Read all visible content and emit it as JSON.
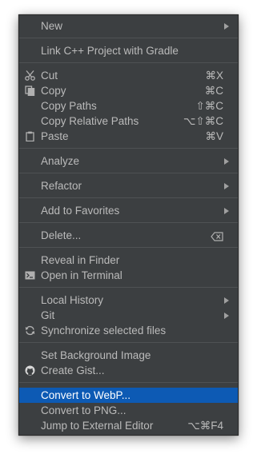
{
  "menu": {
    "new": {
      "label": "New"
    },
    "link_cpp": {
      "label": "Link C++ Project with Gradle"
    },
    "cut": {
      "label": "Cut",
      "shortcut": "⌘X",
      "icon": "scissors-icon"
    },
    "copy": {
      "label": "Copy",
      "shortcut": "⌘C",
      "icon": "copy-icon"
    },
    "copy_paths": {
      "label": "Copy Paths",
      "shortcut": "⇧⌘C"
    },
    "copy_relative_paths": {
      "label": "Copy Relative Paths",
      "shortcut": "⌥⇧⌘C"
    },
    "paste": {
      "label": "Paste",
      "shortcut": "⌘V",
      "icon": "clipboard-icon"
    },
    "analyze": {
      "label": "Analyze"
    },
    "refactor": {
      "label": "Refactor"
    },
    "add_to_favorites": {
      "label": "Add to Favorites"
    },
    "delete": {
      "label": "Delete...",
      "shortcut_icon": "delete-key-icon"
    },
    "reveal_in_finder": {
      "label": "Reveal in Finder"
    },
    "open_in_terminal": {
      "label": "Open in Terminal",
      "icon": "terminal-icon"
    },
    "local_history": {
      "label": "Local History"
    },
    "git": {
      "label": "Git"
    },
    "synchronize": {
      "label": "Synchronize selected files",
      "icon": "sync-icon"
    },
    "set_background": {
      "label": "Set Background Image"
    },
    "create_gist": {
      "label": "Create Gist...",
      "icon": "github-icon"
    },
    "convert_webp": {
      "label": "Convert to WebP...",
      "selected": true
    },
    "convert_png": {
      "label": "Convert to PNG..."
    },
    "jump_external": {
      "label": "Jump to External Editor",
      "shortcut": "⌥⌘F4"
    }
  },
  "colors": {
    "menu_bg": "#3c3f41",
    "text": "#bbbbbb",
    "selected_bg": "#0d5ab4",
    "separator": "#4f5254"
  }
}
